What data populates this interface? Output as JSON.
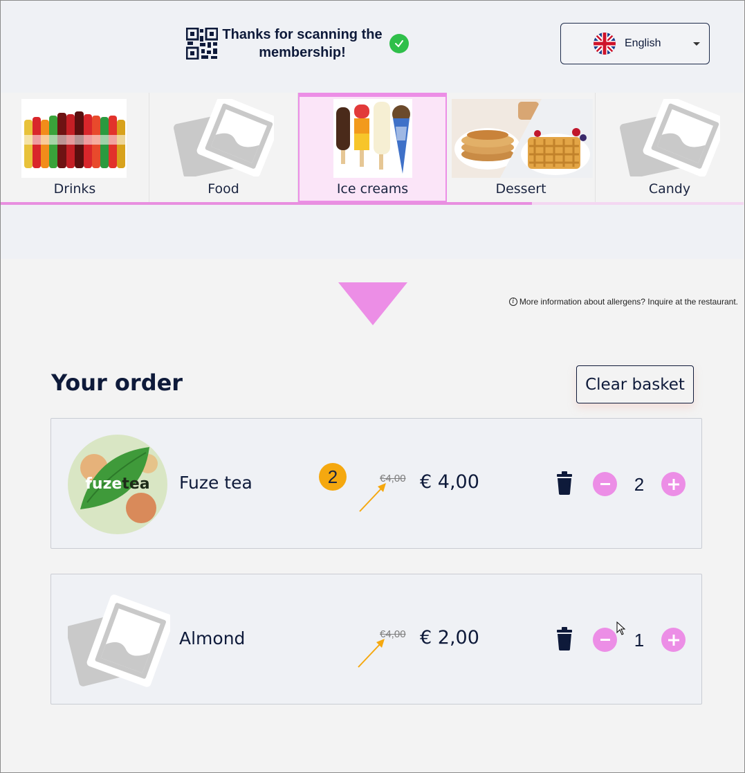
{
  "header": {
    "scan_message": "Thanks for scanning the membership!",
    "language": {
      "label": "English",
      "flag": "uk-flag"
    }
  },
  "categories": [
    {
      "label": "Drinks",
      "image": "drinks-photo",
      "active": false
    },
    {
      "label": "Food",
      "image": "placeholder-image",
      "active": false
    },
    {
      "label": "Ice creams",
      "image": "ice-creams-photo",
      "active": true
    },
    {
      "label": "Dessert",
      "image": "dessert-photo",
      "active": false
    },
    {
      "label": "Candy",
      "image": "placeholder-image",
      "active": false
    }
  ],
  "tab_scroll_progress": 0.715,
  "allergen_note": "More information about allergens? Inquire at the restaurant.",
  "order": {
    "title": "Your order",
    "clear_label": "Clear basket",
    "items": [
      {
        "name": "Fuze tea",
        "old_price": "€4,00",
        "price": "€ 4,00",
        "quantity": "2",
        "badge": "2",
        "image": "fuze-tea-logo"
      },
      {
        "name": "Almond",
        "old_price": "€4,00",
        "price": "€ 2,00",
        "quantity": "1",
        "image": "placeholder-image"
      }
    ]
  },
  "colors": {
    "accent_pink": "#ec8ee6",
    "navy": "#0e1a3a",
    "badge_orange": "#f5a80f",
    "check_green": "#2fbf4a"
  }
}
